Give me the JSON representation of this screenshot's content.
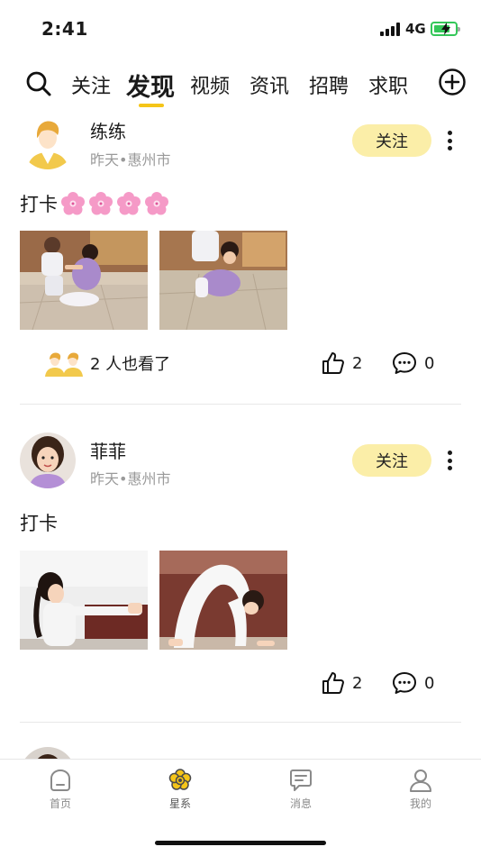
{
  "status_bar": {
    "time": "2:41",
    "network": "4G"
  },
  "nav": {
    "tabs": [
      {
        "label": "关注"
      },
      {
        "label": "发现"
      },
      {
        "label": "视频"
      },
      {
        "label": "资讯"
      },
      {
        "label": "招聘"
      },
      {
        "label": "求职"
      }
    ],
    "active_tab": "发现",
    "accent_color": "#f5c518"
  },
  "posts": [
    {
      "username": "练练",
      "time": "昨天",
      "separator": "•",
      "location": "惠州市",
      "follow_label": "关注",
      "text": "打卡",
      "emoji": [
        "cherry-blossom",
        "cherry-blossom",
        "cherry-blossom",
        "cherry-blossom"
      ],
      "images": 2,
      "viewers_text": "2 人也看了",
      "likes": "2",
      "comments": "0"
    },
    {
      "username": "菲菲",
      "time": "昨天",
      "separator": "•",
      "location": "惠州市",
      "follow_label": "关注",
      "text": "打卡",
      "images": 2,
      "likes": "2",
      "comments": "0"
    }
  ],
  "bottom_nav": {
    "items": [
      {
        "label": "首页",
        "icon": "home-icon"
      },
      {
        "label": "星系",
        "icon": "flower-icon"
      },
      {
        "label": "消息",
        "icon": "message-icon"
      },
      {
        "label": "我的",
        "icon": "person-icon"
      }
    ],
    "active": "星系"
  },
  "colors": {
    "follow_button_bg": "#fbeea8",
    "meta_text": "#9a9a9a"
  }
}
